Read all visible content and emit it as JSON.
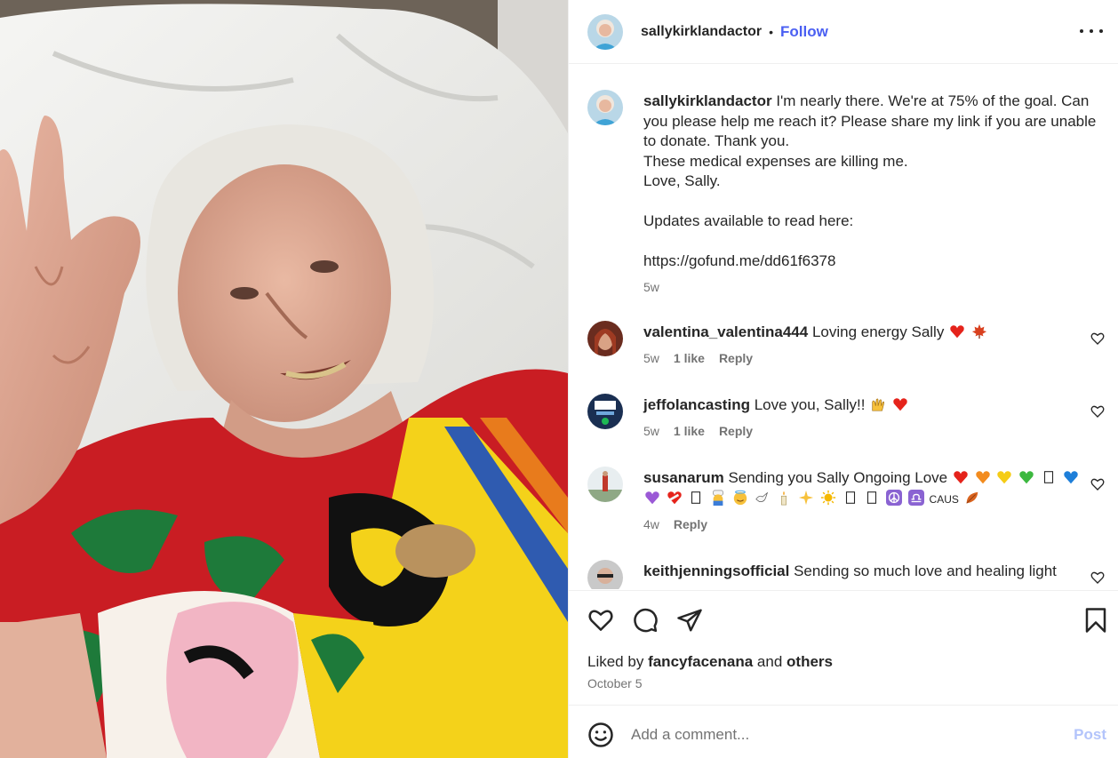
{
  "post": {
    "author": "sallykirklandactor",
    "separator": "•",
    "follow_label": "Follow",
    "more_icon": "more-horizontal-icon"
  },
  "caption": {
    "username": "sallykirklandactor",
    "line1": "I'm nearly there. We're at 75% of the goal. Can you please help me reach it? Please share my link if you are unable to donate. Thank you.",
    "line2": "These medical expenses are killing me.",
    "line3": "Love, Sally.",
    "line4": "Updates available to read here:",
    "link": "https://gofund.me/dd61f6378",
    "age": "5w"
  },
  "comments": [
    {
      "username": "valentina_valentina444",
      "text": "Loving energy Sally",
      "emojis": [
        "red-heart",
        "maple-leaf"
      ],
      "age": "5w",
      "likes": "1 like",
      "reply": "Reply"
    },
    {
      "username": "jeffolancasting",
      "text": "Love you, Sally!!",
      "emojis": [
        "raising-hands",
        "red-heart"
      ],
      "age": "5w",
      "likes": "1 like",
      "reply": "Reply"
    },
    {
      "username": "susanarum",
      "text": "Sending you Sally Ongoing Love",
      "emoji_tail": "CAUS",
      "age": "4w",
      "reply": "Reply"
    },
    {
      "username": "keithjenningsofficial",
      "text": "Sending so much love and healing light"
    }
  ],
  "actions": {
    "like_icon": "heart-icon",
    "comment_icon": "comment-icon",
    "share_icon": "share-icon",
    "save_icon": "bookmark-icon",
    "liked_prefix": "Liked by",
    "liked_user": "fancyfacenana",
    "liked_and": "and",
    "liked_others": "others",
    "date": "October 5"
  },
  "composer": {
    "placeholder": "Add a comment...",
    "post_label": "Post",
    "emoji_icon": "smiley-icon"
  },
  "colors": {
    "follow": "#4a5ff2",
    "post_disabled": "#b3c4fb",
    "muted": "#737373",
    "heart": "#e5231b"
  }
}
